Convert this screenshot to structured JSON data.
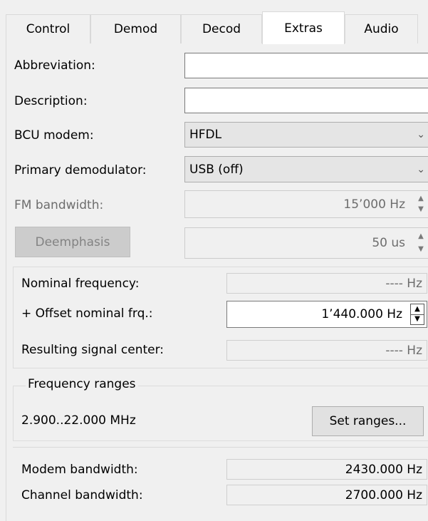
{
  "tabs": [
    {
      "label": "Control"
    },
    {
      "label": "Demod"
    },
    {
      "label": "Decod"
    },
    {
      "label": "Extras",
      "active": true
    },
    {
      "label": "Audio"
    }
  ],
  "form": {
    "abbreviation_label": "Abbreviation:",
    "abbreviation_value": "",
    "description_label": "Description:",
    "description_value": "",
    "bcu_modem_label": "BCU modem:",
    "bcu_modem_value": "HFDL",
    "primary_demod_label": "Primary demodulator:",
    "primary_demod_value": "USB (off)",
    "fm_bandwidth_label": "FM bandwidth:",
    "fm_bandwidth_value": "15’000 Hz",
    "deemphasis_button": "Deemphasis",
    "deemphasis_value": "50 us"
  },
  "frequency": {
    "nominal_label": "Nominal frequency:",
    "nominal_value": "---- Hz",
    "offset_label": "+ Offset nominal frq.:",
    "offset_value": "1’440.000 Hz",
    "resulting_label": "Resulting signal center:",
    "resulting_value": "---- Hz"
  },
  "ranges": {
    "group_title": "Frequency ranges",
    "range_text": "2.900..22.000 MHz",
    "set_button": "Set ranges..."
  },
  "bandwidth": {
    "modem_label": "Modem bandwidth:",
    "modem_value": "2430.000 Hz",
    "channel_label": "Channel bandwidth:",
    "channel_value": "2700.000 Hz"
  },
  "icons": {
    "combo_arrow": "chevron-down-icon",
    "spin": "spin-up-down-icon"
  }
}
